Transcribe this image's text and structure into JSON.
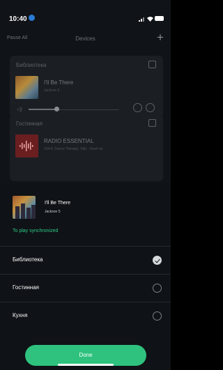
{
  "status_bar": {
    "time": "10:40"
  },
  "header": {
    "left_action": "Pause All",
    "title": "Devices",
    "add_icon": "plus-icon"
  },
  "devices": [
    {
      "room": "Библиотека",
      "song": "I'll Be There",
      "artist": "Jackson 5"
    },
    {
      "room": "Гостинная",
      "song": "RADIO ESSENTIAL",
      "artist": "104.8, Dance Therapy, Tally - Rush vk"
    }
  ],
  "sheet": {
    "now_playing": {
      "title": "I'll Be There",
      "artist": "Jackson 5"
    },
    "sync_label": "To play synchronized",
    "rooms": [
      {
        "label": "Библиотека",
        "checked": true
      },
      {
        "label": "Гостинная",
        "checked": false
      },
      {
        "label": "Кухня",
        "checked": false
      }
    ],
    "done_label": "Done"
  },
  "colors": {
    "accent": "#2ec27e",
    "sync_text": "#2ecb89",
    "background": "#101317"
  }
}
